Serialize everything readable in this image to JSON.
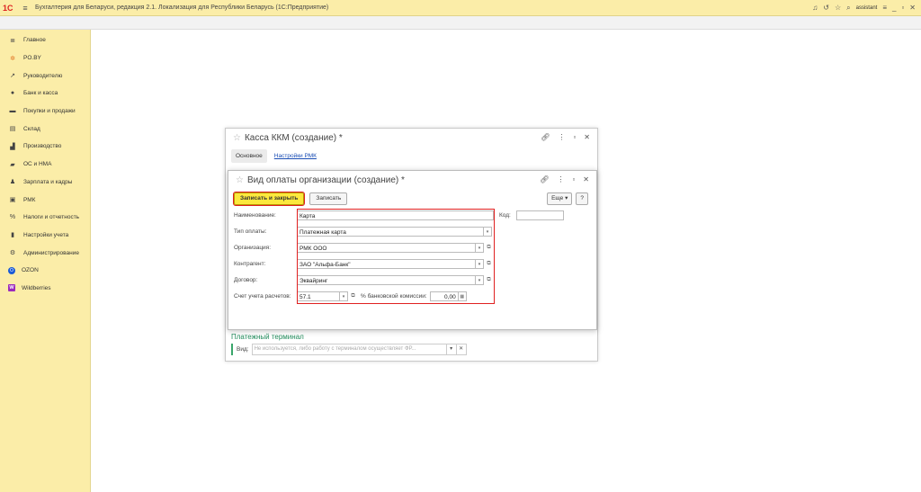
{
  "app": {
    "logo": "1С",
    "title": "Бухгалтерия для Беларуси, редакция 2.1. Локализация для Республики Беларусь   (1С:Предприятие)",
    "user": "assistant"
  },
  "sidebar": {
    "items": [
      {
        "label": "Главное",
        "icon": "≣"
      },
      {
        "label": "PO.BY",
        "icon": "✲"
      },
      {
        "label": "Руководителю",
        "icon": "↗"
      },
      {
        "label": "Банк и касса",
        "icon": "●"
      },
      {
        "label": "Покупки и продажи",
        "icon": "▬"
      },
      {
        "label": "Склад",
        "icon": "▤"
      },
      {
        "label": "Производство",
        "icon": "▟"
      },
      {
        "label": "ОС и НМА",
        "icon": "▰"
      },
      {
        "label": "Зарплата и кадры",
        "icon": "♟"
      },
      {
        "label": "РМК",
        "icon": "▣"
      },
      {
        "label": "Налоги и отчетность",
        "icon": "%"
      },
      {
        "label": "Настройки учета",
        "icon": "▮"
      },
      {
        "label": "Администрирование",
        "icon": "⚙"
      },
      {
        "label": "OZON",
        "icon": "O"
      },
      {
        "label": "Wildberries",
        "icon": "W"
      }
    ]
  },
  "back_window": {
    "title": "Касса ККМ (создание) *",
    "tab_main": "Основное",
    "tab_settings": "Настройки РМК",
    "section": "Платежный терминал",
    "vid_label": "Вид:",
    "vid_placeholder": "Не используется, либо работу с терминалом осуществляет ФР..."
  },
  "front_window": {
    "title": "Вид оплаты организации (создание) *",
    "save_close": "Записать и закрыть",
    "save": "Записать",
    "more": "Еще",
    "help": "?",
    "fields": {
      "name_label": "Наименование:",
      "name_value": "Карта",
      "code_label": "Код:",
      "code_value": "",
      "paytype_label": "Тип оплаты:",
      "paytype_value": "Платежная карта",
      "org_label": "Организация:",
      "org_value": "РМК ООО",
      "contractor_label": "Контрагент:",
      "contractor_value": "ЗАО \"Альфа-Банк\"",
      "contract_label": "Договор:",
      "contract_value": "Эквайринг",
      "account_label": "Счет учета расчетов:",
      "account_value": "57.1",
      "commission_label": "% банковской комиссии:",
      "commission_value": "0,00"
    }
  }
}
